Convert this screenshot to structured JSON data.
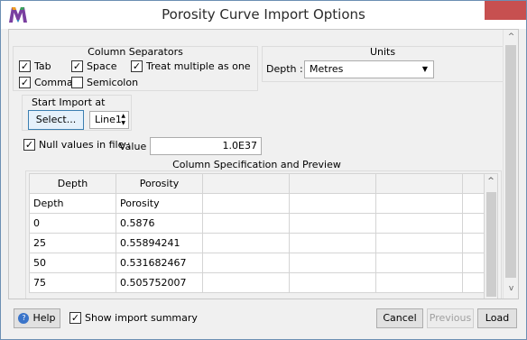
{
  "window": {
    "title": "Porosity Curve  Import Options",
    "close": "✕",
    "accent": "#c75050"
  },
  "separators": {
    "title": "Column Separators",
    "tab": "Tab",
    "space": "Space",
    "treat_multiple": "Treat multiple as one",
    "comma": "Comma",
    "semicolon": "Semicolon",
    "checks": {
      "tab": true,
      "space": true,
      "treat_multiple": true,
      "comma": true,
      "semicolon": false
    }
  },
  "units": {
    "title": "Units",
    "depth_label": "Depth :",
    "depth_value": "Metres"
  },
  "start_import": {
    "title": "Start Import at",
    "select_label": "Select...",
    "line_value": "Line1"
  },
  "null_values": {
    "checked": true,
    "label": "Null values in file :",
    "value_label": "Value",
    "value": "1.0E37"
  },
  "spec": {
    "title": "Column Specification and Preview",
    "columns": [
      "Depth",
      "Porosity",
      "",
      "",
      "",
      ""
    ],
    "rows": [
      [
        "Depth",
        "Porosity",
        "",
        "",
        "",
        ""
      ],
      [
        "0",
        "0.5876",
        "",
        "",
        "",
        ""
      ],
      [
        "25",
        "0.55894241",
        "",
        "",
        "",
        ""
      ],
      [
        "50",
        "0.531682467",
        "",
        "",
        "",
        ""
      ],
      [
        "75",
        "0.505752007",
        "",
        "",
        "",
        ""
      ]
    ]
  },
  "footer": {
    "help_label": "Help",
    "show_summary_label": "Show import summary",
    "show_summary_checked": true,
    "cancel_label": "Cancel",
    "previous_label": "Previous",
    "load_label": "Load"
  },
  "icons": {
    "check": "✓",
    "scroll_up": "^",
    "scroll_down": "v",
    "dropdown": "▼",
    "spin": "▲▼",
    "help": "?"
  }
}
